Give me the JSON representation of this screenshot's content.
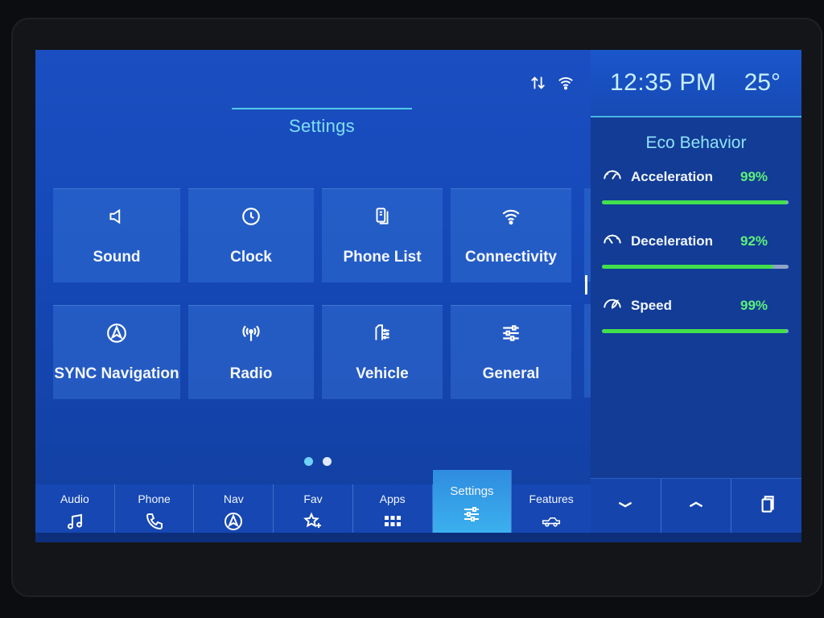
{
  "header": {
    "title": "Settings",
    "status_icons": [
      "data-transfer-icon",
      "wifi-icon"
    ]
  },
  "tiles": [
    {
      "label": "Sound",
      "icon": "speaker-icon"
    },
    {
      "label": "Clock",
      "icon": "clock-icon"
    },
    {
      "label": "Phone List",
      "icon": "phone-list-icon"
    },
    {
      "label": "Connectivity",
      "icon": "wifi-icon"
    },
    {
      "label": "SYNC Navigation",
      "icon": "navigation-icon"
    },
    {
      "label": "Radio",
      "icon": "radio-antenna-icon"
    },
    {
      "label": "Vehicle",
      "icon": "vehicle-settings-icon"
    },
    {
      "label": "General",
      "icon": "sliders-icon"
    }
  ],
  "pagination": {
    "pages": 2,
    "current": 1
  },
  "side_panel": {
    "time": "12:35 PM",
    "temperature": "25°",
    "eco_title": "Eco Behavior",
    "metrics": [
      {
        "name": "Acceleration",
        "value": "99%",
        "level": 0.99
      },
      {
        "name": "Deceleration",
        "value": "92%",
        "level": 0.92
      },
      {
        "name": "Speed",
        "value": "99%",
        "level": 0.99
      }
    ]
  },
  "nav": [
    {
      "label": "Audio",
      "icon": "music-note-icon"
    },
    {
      "label": "Phone",
      "icon": "phone-icon"
    },
    {
      "label": "Nav",
      "icon": "navigation-icon"
    },
    {
      "label": "Fav",
      "icon": "star-plus-icon"
    },
    {
      "label": "Apps",
      "icon": "apps-grid-icon"
    },
    {
      "label": "Settings",
      "icon": "sliders-icon",
      "active": true
    },
    {
      "label": "Features",
      "icon": "truck-icon"
    }
  ],
  "side_controls": [
    "chevron-down-icon",
    "chevron-up-icon",
    "copy-icon"
  ],
  "colors": {
    "accent": "#6fd3f7",
    "eco_green": "#5df279",
    "bar_green": "#43e04e",
    "screen_blue": "#1b4fc1"
  }
}
